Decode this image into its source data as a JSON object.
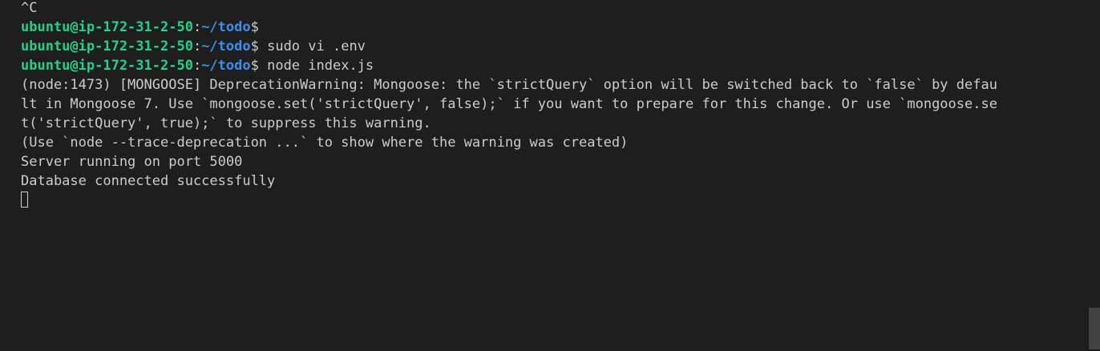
{
  "terminal": {
    "interrupt_line": "^C",
    "prompts": [
      {
        "user_host": "ubuntu@ip-172-31-2-50",
        "separator": ":",
        "path": "~/todo",
        "dollar": "$",
        "command": ""
      },
      {
        "user_host": "ubuntu@ip-172-31-2-50",
        "separator": ":",
        "path": "~/todo",
        "dollar": "$",
        "command": " sudo vi .env"
      },
      {
        "user_host": "ubuntu@ip-172-31-2-50",
        "separator": ":",
        "path": "~/todo",
        "dollar": "$",
        "command": " node index.js"
      }
    ],
    "output_lines": [
      "(node:1473) [MONGOOSE] DeprecationWarning: Mongoose: the `strictQuery` option will be switched back to `false` by defau",
      "lt in Mongoose 7. Use `mongoose.set('strictQuery', false);` if you want to prepare for this change. Or use `mongoose.se",
      "t('strictQuery', true);` to suppress this warning.",
      "(Use `node --trace-deprecation ...` to show where the warning was created)",
      "Server running on port 5000",
      "Database connected successfully"
    ]
  },
  "colors": {
    "background": "#1e1e1e",
    "text": "#cccccc",
    "user_host": "#23d18b",
    "path": "#3b8eea",
    "scrollbar": "#424242"
  }
}
